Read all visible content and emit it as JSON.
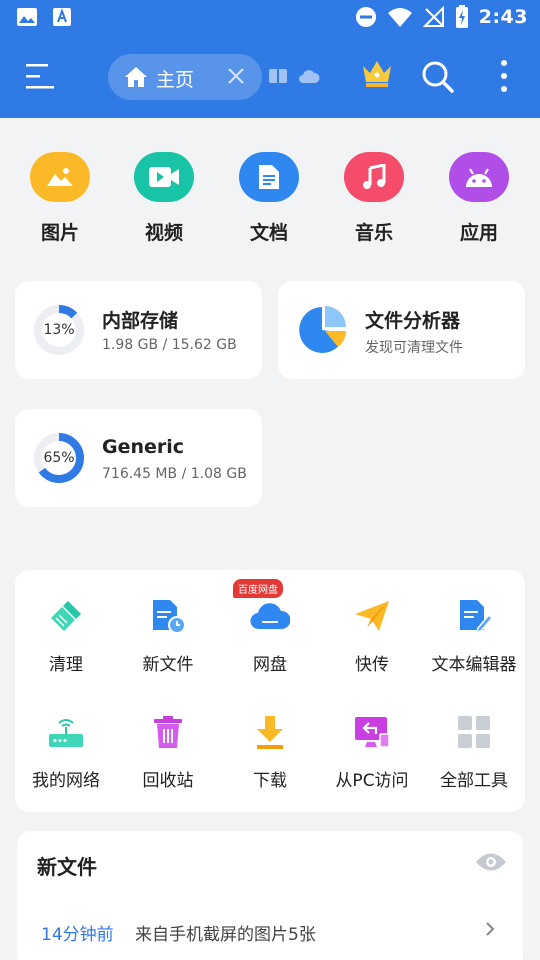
{
  "status_bar": {
    "time": "2:43"
  },
  "app_bar": {
    "home_tab_label": "主页"
  },
  "categories": [
    {
      "label": "图片",
      "color": "#fbb928"
    },
    {
      "label": "视频",
      "color": "#18c3a6"
    },
    {
      "label": "文档",
      "color": "#2f88f0"
    },
    {
      "label": "音乐",
      "color": "#f44c6a"
    },
    {
      "label": "应用",
      "color": "#b24ee8"
    }
  ],
  "storage": {
    "internal": {
      "title": "内部存储",
      "usage": "1.98 GB / 15.62 GB",
      "percent_label": "13%",
      "percent": 13
    },
    "analyzer": {
      "title": "文件分析器",
      "subtitle": "发现可清理文件"
    },
    "generic": {
      "title": "Generic",
      "usage": "716.45 MB / 1.08 GB",
      "percent_label": "65%",
      "percent": 65
    }
  },
  "tools": {
    "cloud_badge": "百度网盘",
    "items": [
      {
        "label": "清理"
      },
      {
        "label": "新文件"
      },
      {
        "label": "网盘"
      },
      {
        "label": "快传"
      },
      {
        "label": "文本编辑器"
      },
      {
        "label": "我的网络"
      },
      {
        "label": "回收站"
      },
      {
        "label": "下载"
      },
      {
        "label": "从PC访问"
      },
      {
        "label": "全部工具"
      }
    ]
  },
  "new_files": {
    "title": "新文件",
    "rows": [
      {
        "time": "14分钟前",
        "description": "来自手机截屏的图片5张"
      }
    ]
  },
  "colors": {
    "primary": "#2f7ae5",
    "background": "#f2f3f5",
    "badge": "#e53935"
  }
}
